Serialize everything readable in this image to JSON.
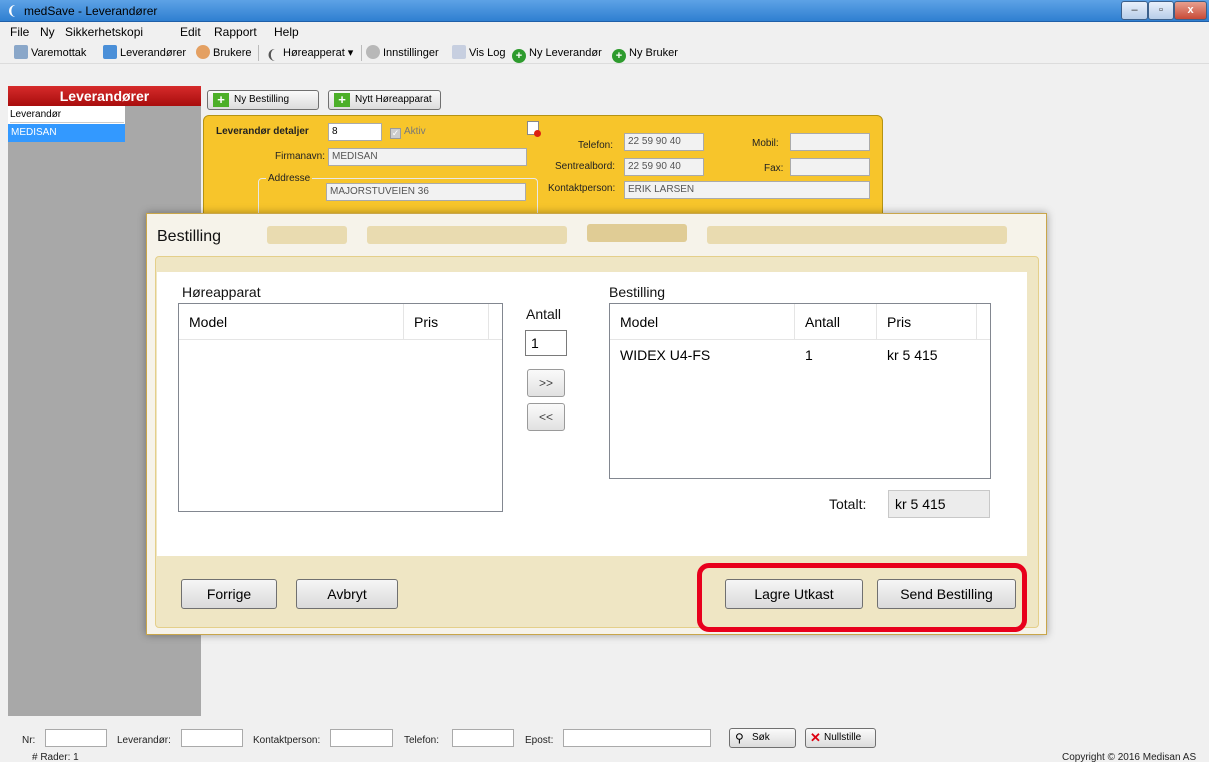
{
  "window": {
    "title": "medSave - Leverandører",
    "controls": [
      "–",
      "▫",
      "x"
    ]
  },
  "menu": [
    "File",
    "Ny",
    "Sikkerhetskopi",
    "Edit",
    "Rapport",
    "Help"
  ],
  "toolbar": {
    "varemottak": "Varemottak",
    "leverandorer": "Leverandører",
    "brukere": "Brukere",
    "horeapperat": "Høreapperat ▾",
    "innstillinger": "Innstillinger",
    "vislog": "Vis Log",
    "ny_leverandor": "Ny Leverandør",
    "ny_bruker": "Ny Bruker"
  },
  "sidebar": {
    "header": "Leverandører",
    "column": "Leverandør",
    "rows": [
      "MEDISAN"
    ]
  },
  "actions": {
    "ny_bestilling": "Ny Bestilling",
    "nytt_horeapparat": "Nytt Høreapparat"
  },
  "details": {
    "heading": "Leverandør detaljer",
    "id": "8",
    "aktiv": "Aktiv",
    "firmanavn_label": "Firmanavn:",
    "firmanavn": "MEDISAN",
    "addresse_label": "Addresse",
    "address": "MAJORSTUVEIEN 36",
    "telefon_label": "Telefon:",
    "telefon": "22 59 90 40",
    "mobil_label": "Mobil:",
    "sentralbord_label": "Sentrealbord:",
    "sentralbord": "22 59 90 40",
    "fax_label": "Fax:",
    "kontakt_label": "Kontaktperson:",
    "kontakt": "ERIK LARSEN"
  },
  "dialog": {
    "title": "Bestilling",
    "left_label": "Høreapparat",
    "left_columns": [
      "Model",
      "Pris"
    ],
    "antall_label": "Antall",
    "antall_value": "1",
    "add_btn": ">>",
    "remove_btn": "<<",
    "right_label": "Bestilling",
    "right_columns": [
      "Model",
      "Antall",
      "Pris"
    ],
    "order_rows": [
      {
        "model": "WIDEX U4-FS",
        "antall": "1",
        "pris": "kr 5 415"
      }
    ],
    "total_label": "Totalt:",
    "total_value": "kr 5 415",
    "forrige": "Forrige",
    "avbryt": "Avbryt",
    "lagre": "Lagre Utkast",
    "send": "Send Bestilling"
  },
  "search": {
    "nr": "Nr:",
    "leverandor": "Leverandør:",
    "kontaktperson": "Kontaktperson:",
    "telefon": "Telefon:",
    "epost": "Epost:",
    "sok": "Søk",
    "nullstille": "Nullstille"
  },
  "status": {
    "rows": "# Rader: 1",
    "copyright": "Copyright © 2016 Medisan AS"
  },
  "colors": {
    "accent_yellow": "#f7c52b",
    "header_red": "#c01818",
    "highlight": "#e8001c",
    "selection": "#3399ff"
  }
}
